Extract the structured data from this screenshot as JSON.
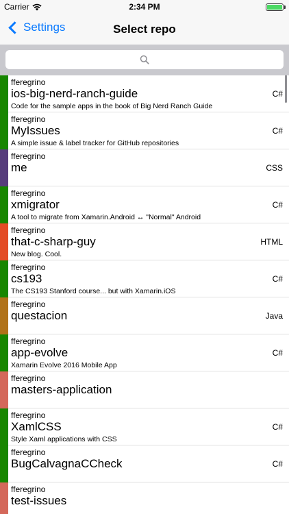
{
  "status_bar": {
    "carrier": "Carrier",
    "time": "2:34 PM",
    "battery_level": 1.0
  },
  "nav": {
    "back_label": "Settings",
    "title": "Select repo"
  },
  "search": {
    "placeholder": ""
  },
  "colors": {
    "accent": "#0a7aff",
    "csharp": "#178600",
    "css": "#563d7c",
    "html": "#e34c26",
    "java": "#b07219",
    "none": "#d4685a"
  },
  "repos": [
    {
      "owner": "fferegrino",
      "name": "ios-big-nerd-ranch-guide",
      "description": "Code for the sample apps in the book of Big Nerd Ranch Guide",
      "language": "C#",
      "color": "#178600"
    },
    {
      "owner": "fferegrino",
      "name": "MyIssues",
      "description": "A simple issue & label tracker for GitHub repositories",
      "language": "C#",
      "color": "#178600"
    },
    {
      "owner": "fferegrino",
      "name": "me",
      "description": "",
      "language": "CSS",
      "color": "#563d7c"
    },
    {
      "owner": "fferegrino",
      "name": "xmigrator",
      "description": "A tool to migrate from Xamarin.Android ↔ \"Normal\" Android",
      "language": "C#",
      "color": "#178600"
    },
    {
      "owner": "fferegrino",
      "name": "that-c-sharp-guy",
      "description": "New blog. Cool.",
      "language": "HTML",
      "color": "#e34c26"
    },
    {
      "owner": "fferegrino",
      "name": "cs193",
      "description": "The CS193 Stanford course... but with Xamarin.iOS",
      "language": "C#",
      "color": "#178600"
    },
    {
      "owner": "fferegrino",
      "name": "questacion",
      "description": "",
      "language": "Java",
      "color": "#b07219"
    },
    {
      "owner": "fferegrino",
      "name": "app-evolve",
      "description": "Xamarin Evolve 2016 Mobile App",
      "language": "C#",
      "color": "#178600"
    },
    {
      "owner": "fferegrino",
      "name": "masters-application",
      "description": "",
      "language": "",
      "color": "#d4685a"
    },
    {
      "owner": "fferegrino",
      "name": "XamlCSS",
      "description": "Style Xaml applications with CSS",
      "language": "C#",
      "color": "#178600"
    },
    {
      "owner": "fferegrino",
      "name": "BugCalvagnaCCheck",
      "description": "",
      "language": "C#",
      "color": "#178600"
    },
    {
      "owner": "fferegrino",
      "name": "test-issues",
      "description": "",
      "language": "",
      "color": "#d4685a"
    }
  ]
}
